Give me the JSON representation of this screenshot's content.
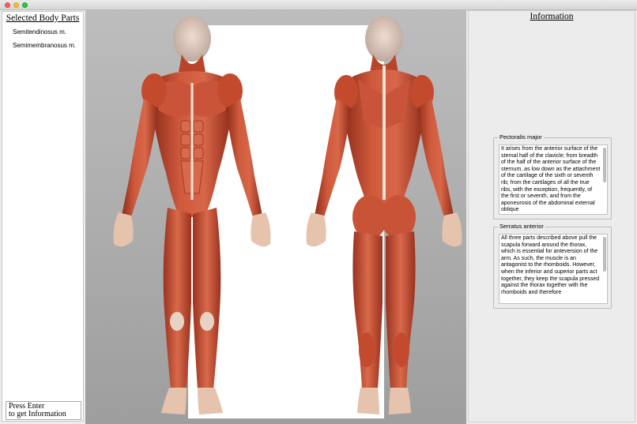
{
  "window": {
    "close": "close",
    "minimize": "minimize",
    "maximize": "maximize"
  },
  "left": {
    "title": "Selected Body Parts",
    "items": [
      {
        "label": "Semitendinosus m."
      },
      {
        "label": "Semimembranosus m."
      }
    ],
    "hint_line1": "Press Enter",
    "hint_line2": "to get Information"
  },
  "center": {
    "image": "human muscular anatomy, front and back view"
  },
  "right": {
    "title": "Information",
    "groups": [
      {
        "label": "Pectoralis major",
        "text": "It arises from the anterior surface of the sternal half of the clavicle; from breadth of the half of the anterior surface of the sternum, as low down as the attachment of the cartilage of the sixth or seventh rib; from the cartilages of all the true ribs, with the exception, frequently, of the first or seventh, and from the aponeurosis of the abdominal external oblique"
      },
      {
        "label": "Serratus anterior",
        "text": "All three parts described above pull the scapula forward around the thorax, which is essential for anteversion of the arm. As such, the muscle is an antagonist to the rhomboids. However, when the inferior and superior parts act together, they keep the scapula pressed against the thorax together with the rhomboids and therefore"
      }
    ]
  },
  "colors": {
    "muscle": "#c44a2e",
    "muscle_dark": "#962f1c",
    "tendon": "#efe5d8",
    "skin": "#e6c3ad"
  }
}
